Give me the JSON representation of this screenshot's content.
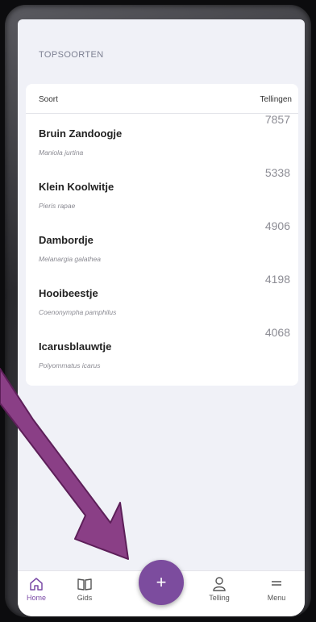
{
  "header": {
    "section_title": "TOPSOORTEN"
  },
  "table": {
    "col_left": "Soort",
    "col_right": "Tellingen",
    "rows": [
      {
        "name": "Bruin Zandoogje",
        "latin": "Maniola jurtina",
        "count": "7857"
      },
      {
        "name": "Klein Koolwitje",
        "latin": "Pieris rapae",
        "count": "5338"
      },
      {
        "name": "Dambordje",
        "latin": "Melanargia galathea",
        "count": "4906"
      },
      {
        "name": "Hooibeestje",
        "latin": "Coenonympha pamphilus",
        "count": "4198"
      },
      {
        "name": "Icarusblauwtje",
        "latin": "Polyommatus icarus",
        "count": "4068"
      }
    ]
  },
  "nav": {
    "home": "Home",
    "gids": "Gids",
    "fab": "+",
    "telling": "Telling",
    "menu": "Menu"
  },
  "colors": {
    "accent": "#7c4c9e",
    "arrow": "#8a3f86"
  },
  "icons": [
    "home-icon",
    "book-icon",
    "plus-icon",
    "user-icon",
    "menu-icon"
  ]
}
